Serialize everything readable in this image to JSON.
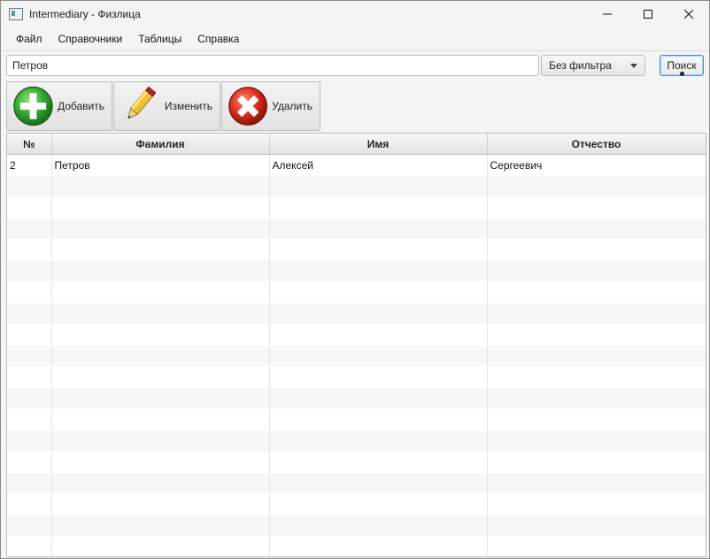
{
  "window": {
    "title": "Intermediary - Физлица",
    "icons": {
      "minimize": "minimize-icon",
      "maximize": "maximize-icon",
      "close": "close-icon"
    }
  },
  "menu": {
    "items": [
      "Файл",
      "Справочники",
      "Таблицы",
      "Справка"
    ]
  },
  "search": {
    "value": "Петров",
    "filter_selected": "Без фильтра",
    "button_label": "Поиск"
  },
  "toolbar": {
    "add_label": "Добавить",
    "edit_label": "Изменить",
    "delete_label": "Удалить",
    "icons": {
      "add": "add-plus-icon",
      "edit": "pencil-icon",
      "delete": "delete-x-icon"
    },
    "colors": {
      "add": "#2fa52f",
      "delete": "#d92a1c",
      "edit": "#f2c12e"
    }
  },
  "table": {
    "columns": [
      "№",
      "Фамилия",
      "Имя",
      "Отчество"
    ],
    "rows": [
      [
        "2",
        "Петров",
        "Алексей",
        "Сергеевич"
      ]
    ]
  },
  "colors": {
    "focus_border": "#4a90d9",
    "stripe": "#f7f7f7"
  }
}
